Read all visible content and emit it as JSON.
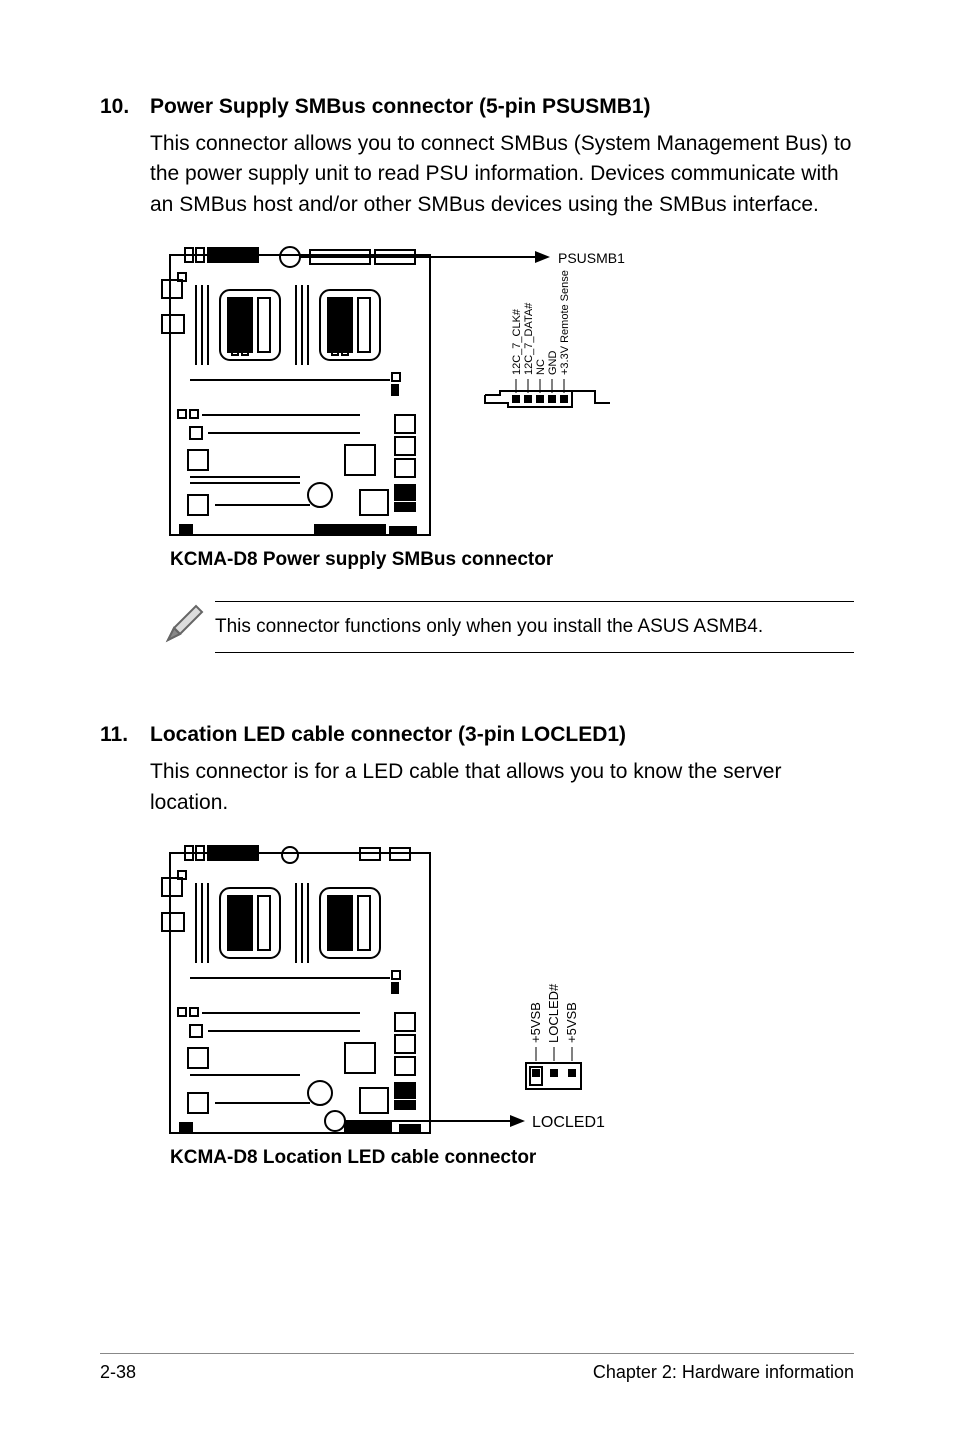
{
  "section10": {
    "number": "10.",
    "title": "Power Supply SMBus connector (5-pin PSUSMB1)",
    "body": "This connector allows you to connect SMBus (System Management Bus) to the power supply unit to read PSU information. Devices communicate with an SMBus host and/or other SMBus devices using the SMBus interface.",
    "connector_label": "PSUSMB1",
    "pins": [
      "12C_7_CLK#",
      "12C_7_DATA#",
      "NC",
      "GND",
      "+3.3V Remote Sense"
    ],
    "caption": "KCMA-D8 Power supply SMBus connector"
  },
  "note": {
    "text": "This connector functions only when you install the ASUS ASMB4."
  },
  "section11": {
    "number": "11.",
    "title": "Location LED cable connector (3-pin LOCLED1)",
    "body": "This connector is for a LED cable that allows you to know the server location.",
    "connector_label": "LOCLED1",
    "pins": [
      "+5VSB",
      "LOCLED#",
      "+5VSB"
    ],
    "caption": "KCMA-D8 Location LED cable connector"
  },
  "footer": {
    "left": "2-38",
    "right": "Chapter 2: Hardware information"
  }
}
